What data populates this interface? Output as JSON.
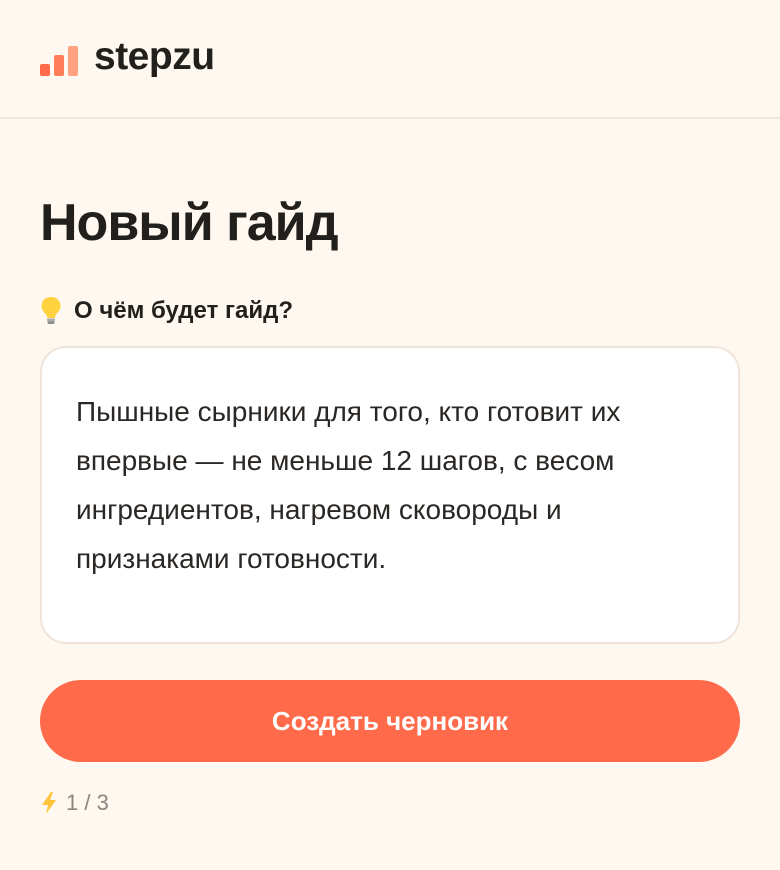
{
  "header": {
    "brand": "stepzu",
    "colors": {
      "bar1": "#ff6b4a",
      "bar2": "#ff7e59",
      "bar3": "#ffa27f"
    }
  },
  "main": {
    "title": "Новый гайд",
    "prompt": {
      "icon": "lightbulb-icon",
      "label": "О чём будет гайд?"
    },
    "input": {
      "value": "Пышные сырники для того, кто готовит их впервые — не меньше 12 шагов, с весом ингредиентов, нагревом сковороды и признаками готовности."
    },
    "create_button": {
      "label": "Создать черновик",
      "color": "#ff6b4a"
    },
    "usage": {
      "icon": "lightning-icon",
      "text": "1 / 3"
    }
  }
}
